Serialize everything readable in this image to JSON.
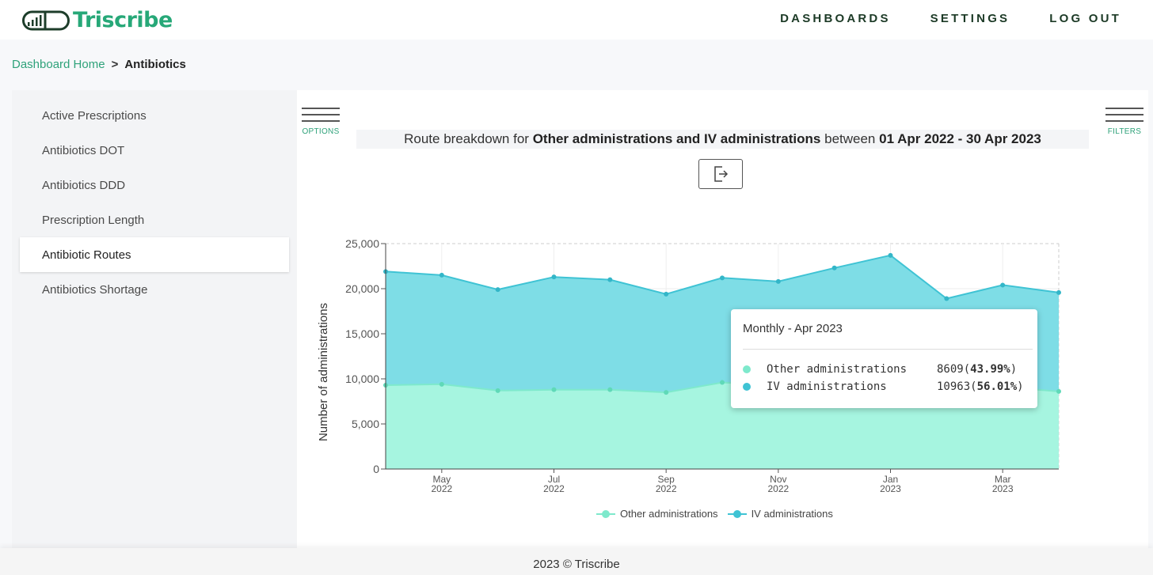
{
  "header": {
    "brand": "Triscribe",
    "nav": [
      "DASHBOARDS",
      "SETTINGS",
      "LOG OUT"
    ]
  },
  "breadcrumb": {
    "home": "Dashboard Home",
    "separator": ">",
    "current": "Antibiotics"
  },
  "sidebar": {
    "items": [
      {
        "label": "Active Prescriptions",
        "active": false
      },
      {
        "label": "Antibiotics DOT",
        "active": false
      },
      {
        "label": "Antibiotics DDD",
        "active": false
      },
      {
        "label": "Prescription Length",
        "active": false
      },
      {
        "label": "Antibiotic Routes",
        "active": true
      },
      {
        "label": "Antibiotics Shortage",
        "active": false
      }
    ]
  },
  "panel": {
    "options_label": "OPTIONS",
    "filters_label": "FILTERS",
    "title": {
      "prefix": "Route breakdown for",
      "subject": "Other administrations and IV administrations",
      "middle": "between",
      "range": "01 Apr 2022 - 30 Apr 2023"
    }
  },
  "tooltip": {
    "title": "Monthly - Apr 2023",
    "rows": [
      {
        "name": "Other administrations",
        "value": "8609",
        "pct": "43.99%"
      },
      {
        "name": "IV administrations",
        "value": "10963",
        "pct": "56.01%"
      }
    ]
  },
  "colors": {
    "other": "#7ee9cc",
    "iv": "#3fc3d4",
    "accent": "#2fa27a"
  },
  "chart_data": {
    "type": "area",
    "stacked": true,
    "x": [
      "2022-04",
      "2022-05",
      "2022-06",
      "2022-07",
      "2022-08",
      "2022-09",
      "2022-10",
      "2022-11",
      "2022-12",
      "2023-01",
      "2023-02",
      "2023-03",
      "2023-04"
    ],
    "x_tick_labels": [
      {
        "month": "May",
        "year": "2022",
        "at": "2022-05"
      },
      {
        "month": "Jul",
        "year": "2022",
        "at": "2022-07"
      },
      {
        "month": "Sep",
        "year": "2022",
        "at": "2022-09"
      },
      {
        "month": "Nov",
        "year": "2022",
        "at": "2022-11"
      },
      {
        "month": "Jan",
        "year": "2023",
        "at": "2023-01"
      },
      {
        "month": "Mar",
        "year": "2023",
        "at": "2023-03"
      }
    ],
    "series": [
      {
        "name": "Other administrations",
        "values": [
          9300,
          9400,
          8700,
          8800,
          8800,
          8500,
          9600,
          9300,
          9300,
          9400,
          8800,
          9100,
          8609
        ]
      },
      {
        "name": "IV administrations",
        "values": [
          12600,
          12100,
          11200,
          12500,
          12200,
          10900,
          11600,
          11500,
          13000,
          14300,
          10100,
          11300,
          10963
        ]
      }
    ],
    "ylabel": "Number of administrations",
    "ylim": [
      0,
      25000
    ],
    "yticks": [
      "0",
      "5,000",
      "10,000",
      "15,000",
      "20,000",
      "25,000"
    ],
    "grid": true,
    "legend": "bottom"
  },
  "footer": "2023 © Triscribe"
}
